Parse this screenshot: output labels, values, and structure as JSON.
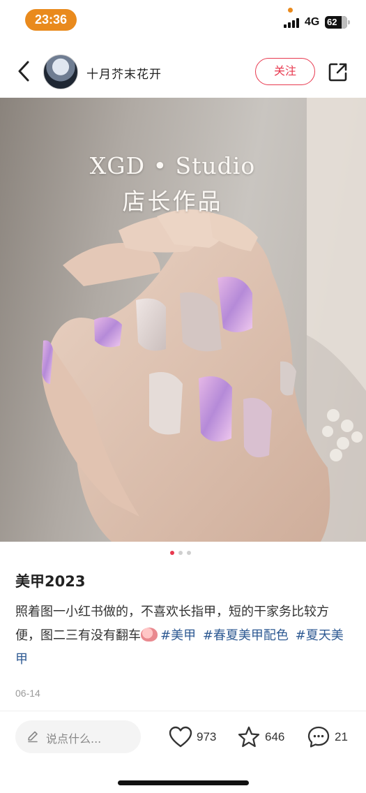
{
  "status_bar": {
    "time": "23:36",
    "network": "4G",
    "battery": "62"
  },
  "header": {
    "author_name": "十月芥末花开",
    "follow_label": "关注"
  },
  "photo": {
    "title_line1": "XGD • Studio",
    "title_line2": "店长作品"
  },
  "carousel": {
    "total": 3,
    "active": 1
  },
  "post": {
    "title": "美甲2023",
    "body": "照着图一小红书做的，不喜欢长指甲，短的干家务比较方便，图二三有没有翻车",
    "tags": [
      "#美甲",
      "#春夏美甲配色",
      "#夏天美甲"
    ],
    "date": "06-14"
  },
  "bottom_bar": {
    "comment_placeholder": "说点什么...",
    "likes": "973",
    "favorites": "646",
    "comments": "21"
  },
  "colors": {
    "accent": "#e8394f",
    "tag": "#2e5a93",
    "time_pill": "#e98a1d"
  }
}
